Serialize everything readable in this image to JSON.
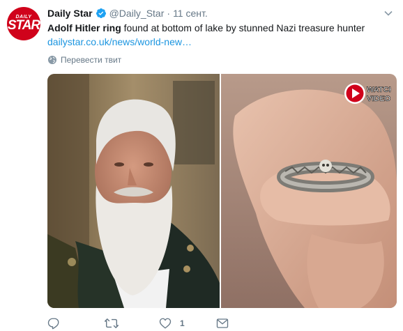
{
  "tweet": {
    "author": {
      "name": "Daily Star",
      "handle": "@Daily_Star",
      "avatar_top": "DAILY",
      "avatar_bottom": "STAR",
      "verified": true
    },
    "separator": "·",
    "timestamp": "11 сент.",
    "text_bold_1": "Adolf Hitler ring",
    "text_rest": " found at bottom of lake by stunned Nazi treasure hunter",
    "link": "dailystar.co.uk/news/world-new…",
    "translate_label": "Перевести твит",
    "media": {
      "badge_line1": "WATCH",
      "badge_line2": "VIDEO"
    },
    "actions": {
      "reply_count": "",
      "retweet_count": "",
      "like_count": "1",
      "dm_count": ""
    }
  },
  "colors": {
    "link": "#1b95e0",
    "muted": "#657786",
    "brand_red": "#d0021b",
    "verified_blue": "#1da1f2"
  }
}
